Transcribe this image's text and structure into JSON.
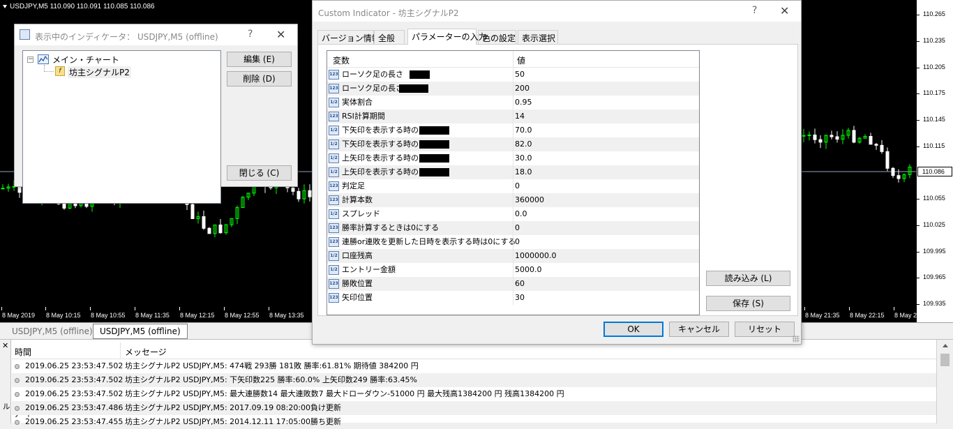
{
  "chart": {
    "title": "USDJPY,M5  110.090 110.091 110.085 110.086",
    "colors": {
      "background": "#000000",
      "bull": "#00ff00",
      "bear": "#ffffff",
      "grid": "#404040"
    },
    "price_labels": [
      "110.265",
      "110.235",
      "110.205",
      "110.175",
      "110.145",
      "110.115",
      "110.055",
      "110.025",
      "109.995",
      "109.965",
      "109.935"
    ],
    "current_price": "110.086",
    "time_labels": [
      "8 May 2019",
      "8 May 10:15",
      "8 May 10:55",
      "8 May 11:35",
      "8 May 12:15",
      "8 May 12:55",
      "8 May 13:35",
      "8 May 21:35",
      "8 May 22:15",
      "8 May 22:55"
    ]
  },
  "chart_tabs": [
    "USDJPY,M5 (offline)",
    "USDJPY,M5 (offline)"
  ],
  "indicators_window": {
    "title": "表示中のインディケータ： USDJPY,M5 (offline)",
    "help": "?",
    "close": "✕",
    "tree_root": "メイン・チャート",
    "tree_child": "坊主シグナルP2",
    "buttons": {
      "edit": "編集 (E)",
      "delete": "削除 (D)",
      "close": "閉じる (C)"
    }
  },
  "param_window": {
    "title": "Custom Indicator - 坊主シグナルP2",
    "help": "?",
    "close": "✕",
    "tabs": [
      "バージョン情報",
      "全般",
      "パラメーターの入力",
      "色の設定",
      "表示選択"
    ],
    "active_tab": 2,
    "columns": {
      "name": "変数",
      "value": "値"
    },
    "params": [
      {
        "type": "123",
        "name": "ローソク足の長さ",
        "value": "50"
      },
      {
        "type": "123",
        "name": "ローソク足の長さ",
        "value": "200"
      },
      {
        "type": "1/2",
        "name": "実体割合",
        "value": "0.95"
      },
      {
        "type": "123",
        "name": "RSI計算期間",
        "value": "14"
      },
      {
        "type": "1/2",
        "name": "下矢印を表示する時の",
        "value": "70.0"
      },
      {
        "type": "1/2",
        "name": "下矢印を表示する時の",
        "value": "82.0"
      },
      {
        "type": "1/2",
        "name": "上矢印を表示する時の",
        "value": "30.0"
      },
      {
        "type": "1/2",
        "name": "上矢印を表示する時の",
        "value": "18.0"
      },
      {
        "type": "123",
        "name": "判定足",
        "value": "0"
      },
      {
        "type": "123",
        "name": "計算本数",
        "value": "360000"
      },
      {
        "type": "1/2",
        "name": "スプレッド",
        "value": "0.0"
      },
      {
        "type": "123",
        "name": "勝率計算するときは0にする",
        "value": "0"
      },
      {
        "type": "123",
        "name": "連勝or連敗を更新した日時を表示する時は0にする",
        "value": "0"
      },
      {
        "type": "1/2",
        "name": "口座残高",
        "value": "1000000.0"
      },
      {
        "type": "1/2",
        "name": "エントリー金額",
        "value": "5000.0"
      },
      {
        "type": "123",
        "name": "勝敗位置",
        "value": "60"
      },
      {
        "type": "123",
        "name": "矢印位置",
        "value": "30"
      }
    ],
    "buttons": {
      "load": "読み込み (L)",
      "save": "保存 (S)",
      "ok": "OK",
      "cancel": "キャンセル",
      "reset": "リセット"
    }
  },
  "terminal": {
    "close": "✕",
    "side_label": "ターミナル",
    "columns": {
      "time": "時間",
      "message": "メッセージ"
    },
    "rows": [
      {
        "time": "2019.06.25 23:53:47.502",
        "message": "坊主シグナルP2 USDJPY,M5: 474戦  293勝  181敗  勝率:61.81%  期待値 384200 円"
      },
      {
        "time": "2019.06.25 23:53:47.502",
        "message": "坊主シグナルP2 USDJPY,M5: 下矢印数225  勝率:60.0%    上矢印数249  勝率:63.45%"
      },
      {
        "time": "2019.06.25 23:53:47.502",
        "message": "坊主シグナルP2 USDJPY,M5: 最大連勝数14  最大連敗数7      最大ドローダウン-51000 円    最大残高1384200 円    残高1384200 円"
      },
      {
        "time": "2019.06.25 23:53:47.486",
        "message": "坊主シグナルP2 USDJPY,M5: 2017.09.19 08:20:00負け更新"
      },
      {
        "time": "2019.06.25 23:53:47.455",
        "message": "坊主シグナルP2 USDJPY,M5: 2014.12.11 17:05:00勝ち更新"
      }
    ]
  }
}
